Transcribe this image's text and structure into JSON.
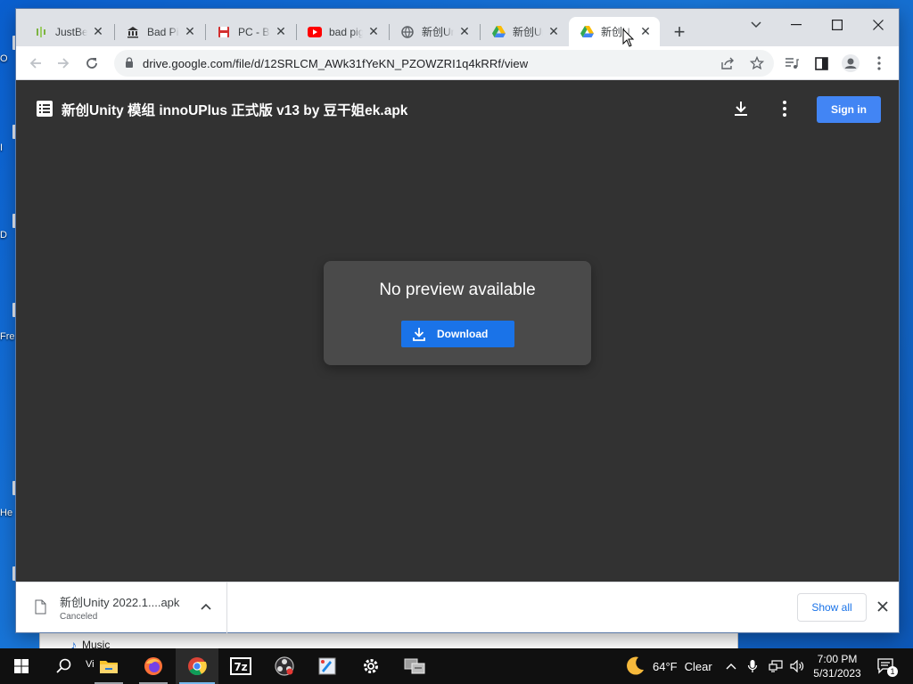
{
  "desktop": {
    "labels": [
      "O",
      "I",
      "D",
      "Fre",
      "He"
    ],
    "background_window": {
      "item_label": "Music",
      "taskbar_peek_label": "Vi"
    }
  },
  "browser": {
    "tabs": [
      {
        "title": "JustBe",
        "favicon": "justbeats-icon",
        "active": false
      },
      {
        "title": "Bad Pig",
        "favicon": "museum-icon",
        "active": false
      },
      {
        "title": "PC - Ba",
        "favicon": "floppy-icon",
        "active": false
      },
      {
        "title": "bad pig",
        "favicon": "youtube-icon",
        "active": false
      },
      {
        "title": "新创Ur",
        "favicon": "globe-icon",
        "active": false
      },
      {
        "title": "新创Ur",
        "favicon": "google-drive-icon",
        "active": false
      },
      {
        "title": "新创U",
        "favicon": "google-drive-icon",
        "active": true
      }
    ],
    "url": "drive.google.com/file/d/12SRLCM_AWk31fYeKN_PZOWZRI1q4kRRf/view",
    "accent": "#1a73e8"
  },
  "viewer": {
    "file_title": "新创Unity 模组 innoUPlus 正式版 v13 by 豆干姐ek.apk",
    "sign_in_label": "Sign in",
    "no_preview_text": "No preview available",
    "download_label": "Download",
    "background": "#323232"
  },
  "download_bar": {
    "file_name": "新创Unity 2022.1....apk",
    "status": "Canceled",
    "show_all_label": "Show all"
  },
  "taskbar": {
    "weather": {
      "temp": "64°F",
      "condition": "Clear"
    },
    "time": "7:00 PM",
    "date": "5/31/2023",
    "notification_count": "1",
    "apps": [
      "start-icon",
      "search-icon",
      "file-explorer-icon",
      "firefox-icon",
      "chrome-icon",
      "7zip-icon",
      "obs-icon",
      "paint-icon",
      "settings-icon",
      "network-app-icon"
    ]
  }
}
